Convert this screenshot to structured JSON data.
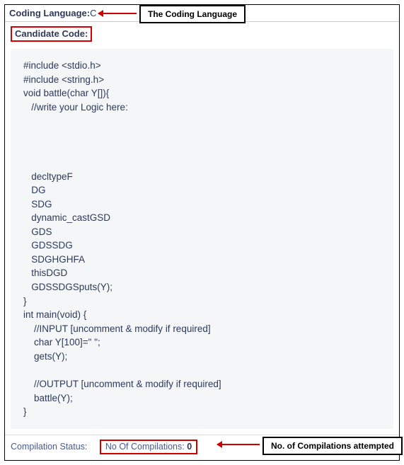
{
  "header": {
    "lang_label": "Coding Language:",
    "lang_value": "C",
    "candidate_code_label": "Candidate Code:"
  },
  "callouts": {
    "lang": "The Coding Language",
    "comp": "No. of Compilations attempted"
  },
  "code": "#include <stdio.h>\n#include <string.h>\nvoid battle(char Y[]){\n   //write your Logic here:\n\n\n\n\n   decltypeF\n   DG\n   SDG\n   dynamic_castGSD\n   GDS\n   GDSSDG\n   SDGHGHFA\n   thisDGD\n   GDSSDGSputs(Y);\n}\nint main(void) {\n    //INPUT [uncomment & modify if required]\n    char Y[100]=\" \";\n    gets(Y);\n\n    //OUTPUT [uncomment & modify if required]\n    battle(Y);\n}",
  "status": {
    "label": "Compilation Status:",
    "comp_label": "No Of Compilations: ",
    "comp_count": "0"
  }
}
